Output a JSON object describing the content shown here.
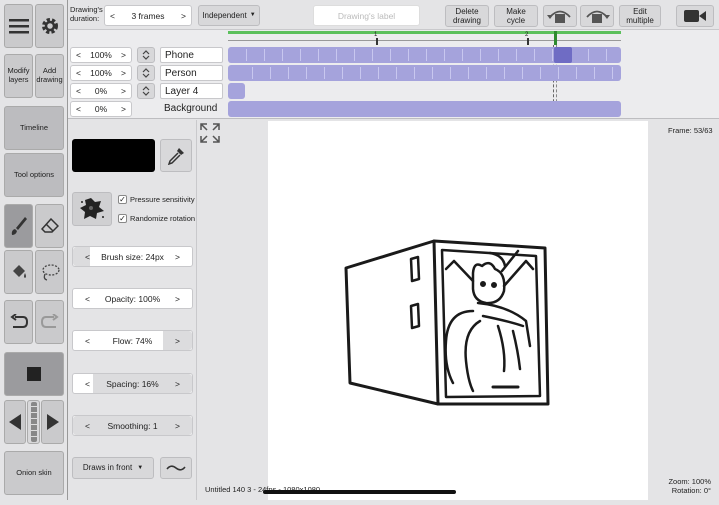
{
  "top_bar": {
    "duration_label": "Drawing's\nduration:",
    "duration_value": "3 frames",
    "mode": "Independent",
    "label_placeholder": "Drawing's label",
    "delete_drawing": "Delete\ndrawing",
    "make_cycle": "Make\ncycle",
    "edit_multiple": "Edit\nmultiple"
  },
  "left_toolbar": {
    "modify_layers": "Modify\nlayers",
    "add_drawing": "Add\ndrawing",
    "timeline": "Timeline",
    "tool_options": "Tool options",
    "onion_skin": "Onion skin"
  },
  "timeline": {
    "ruler_marks": [
      "1",
      "2"
    ],
    "layers": [
      {
        "opacity": "100%",
        "name": "Phone"
      },
      {
        "opacity": "100%",
        "name": "Person"
      },
      {
        "opacity": "0%",
        "name": "Layer 4"
      },
      {
        "opacity": "0%",
        "name": "Background"
      }
    ]
  },
  "tool_options": {
    "pressure_sensitivity": "Pressure sensitivity",
    "randomize_rotation": "Randomize rotation",
    "brush_size": "Brush size: 24px",
    "opacity": "Opacity: 100%",
    "flow": "Flow: 74%",
    "spacing": "Spacing: 16%",
    "smoothing": "Smoothing: 1",
    "draw_order": "Draws in front",
    "lt": "<",
    "gt": ">"
  },
  "canvas": {
    "frame": "Frame: 53/63",
    "status": "Untitled 140 3 - 24fps - 1080x1080",
    "zoom": "Zoom: 100%",
    "rotation": "Rotation: 0°"
  },
  "colors": {
    "accent": "#a5a3dc",
    "current_frame": "#2e8a2e",
    "swatch": "#000000"
  }
}
